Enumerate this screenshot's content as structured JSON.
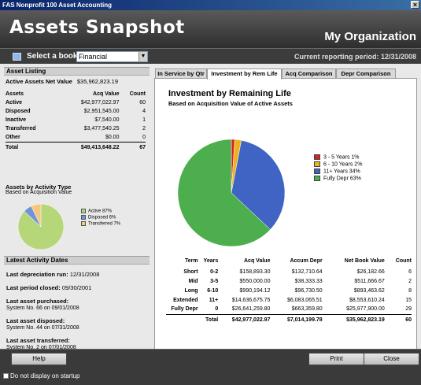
{
  "window": {
    "title": "FAS Nonprofit 100 Asset Accounting",
    "close_glyph": "×"
  },
  "banner": {
    "title": "Assets Snapshot",
    "organization": "My Organization"
  },
  "bookbar": {
    "label": "Select a book",
    "selected_book": "Financial",
    "period": "Current reporting period: 12/31/2008"
  },
  "asset_listing": {
    "heading": "Asset Listing",
    "net_label": "Active Assets Net Value",
    "net_value": "$35,962,823.19",
    "columns": [
      "Assets",
      "Acq Value",
      "Count"
    ],
    "rows": [
      {
        "label": "Active",
        "value": "$42,977,022.97",
        "count": "60"
      },
      {
        "label": "Disposed",
        "value": "$2,951,545.00",
        "count": "4"
      },
      {
        "label": "Inactive",
        "value": "$7,540.00",
        "count": "1"
      },
      {
        "label": "Transferred",
        "value": "$3,477,540.25",
        "count": "2"
      },
      {
        "label": "Other",
        "value": "$0.00",
        "count": "0"
      }
    ],
    "total": {
      "label": "Total",
      "value": "$49,413,648.22",
      "count": "67"
    }
  },
  "activity_type": {
    "title": "Assets by Activity Type",
    "subtitle": "Based on Acquisition Value",
    "legend": [
      {
        "label": "Active 87%",
        "color": "#b5d77a"
      },
      {
        "label": "Disposed 6%",
        "color": "#6f93d8"
      },
      {
        "label": "Transferred 7%",
        "color": "#f5c77e"
      }
    ],
    "chart_data": {
      "type": "pie",
      "labels": [
        "Active",
        "Disposed",
        "Transferred"
      ],
      "values": [
        87,
        6,
        7
      ],
      "colors": [
        "#b5d77a",
        "#6f93d8",
        "#f5c77e"
      ]
    }
  },
  "latest": {
    "heading": "Latest Activity Dates",
    "depr_label": "Last depreciation run:",
    "depr_value": "12/31/2008",
    "period_label": "Last period closed:",
    "period_value": "09/30/2001",
    "purchased_label": "Last asset purchased:",
    "purchased_value": "System No. 66 on 09/01/2008",
    "disposed_label": "Last asset disposed:",
    "disposed_value": "System No. 44 on 07/31/2008",
    "transferred_label": "Last asset transferred:",
    "transferred_value": "System No. 2 on 07/01/2008"
  },
  "tabs": [
    "In Service by Qtr",
    "Investment by Rem Life",
    "Acq Comparison",
    "Depr Comparison"
  ],
  "chart": {
    "title": "Investment by Remaining Life",
    "subtitle": "Based on Acquisition Value of Active Assets",
    "legend": [
      {
        "label": "3 - 5 Years 1%",
        "color": "#d92020"
      },
      {
        "label": "6 - 10 Years 2%",
        "color": "#f0b21c"
      },
      {
        "label": "11+ Years 34%",
        "color": "#3f64c4"
      },
      {
        "label": "Fully Depr 63%",
        "color": "#4cae4c"
      }
    ],
    "table_headers": [
      "Term",
      "Years",
      "Acq Value",
      "Accum Depr",
      "Net Book Value",
      "Count"
    ],
    "rows": [
      {
        "term": "Short",
        "years": "0-2",
        "acq": "$158,893.30",
        "accum": "$132,710.64",
        "nbv": "$26,182.66",
        "count": "6"
      },
      {
        "term": "Mid",
        "years": "3-5",
        "acq": "$550,000.00",
        "accum": "$38,333.33",
        "nbv": "$511,666.67",
        "count": "2"
      },
      {
        "term": "Long",
        "years": "6-10",
        "acq": "$990,194.12",
        "accum": "$96,730.50",
        "nbv": "$893,463.62",
        "count": "8"
      },
      {
        "term": "Extended",
        "years": "11+",
        "acq": "$14,636,675.75",
        "accum": "$6,083,065.51",
        "nbv": "$8,553,610.24",
        "count": "15"
      },
      {
        "term": "Fully Depr",
        "years": "0",
        "acq": "$26,641,259.80",
        "accum": "$663,359.80",
        "nbv": "$25,977,900.00",
        "count": "29"
      }
    ],
    "total": {
      "label": "Total",
      "acq": "$42,977,022.97",
      "accum": "$7,014,199.78",
      "nbv": "$35,962,823.19",
      "count": "60"
    },
    "chart_data": {
      "type": "pie",
      "labels": [
        "3 - 5 Years",
        "6 - 10 Years",
        "11+ Years",
        "Fully Depr"
      ],
      "values": [
        1,
        2,
        34,
        63
      ],
      "colors": [
        "#d92020",
        "#f0b21c",
        "#3f64c4",
        "#4cae4c"
      ]
    }
  },
  "buttons": {
    "help": "Help",
    "print": "Print",
    "close": "Close"
  },
  "footer": {
    "startup_label": "Do not display on startup"
  }
}
